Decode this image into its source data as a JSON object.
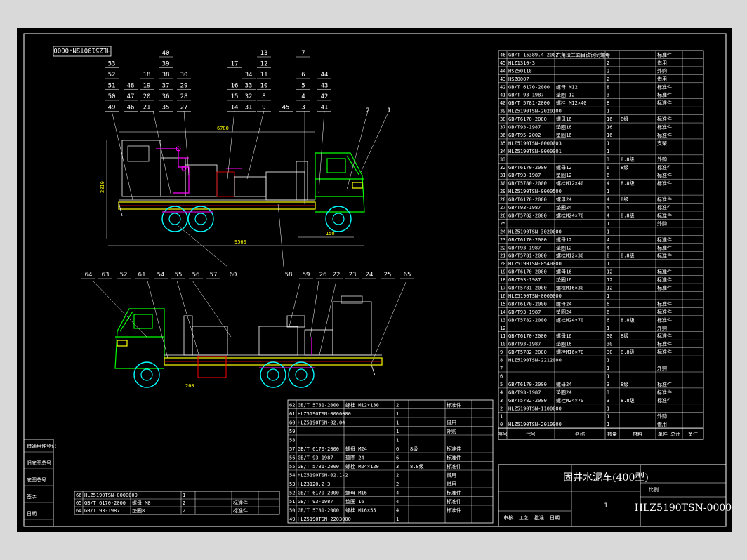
{
  "stamp": "HLZ5190TSN-0000",
  "dimensions": {
    "top_total": "6780",
    "top_height": "2810",
    "top_wheelbase": "9560",
    "top_gap": "150",
    "bottom_gap": "260"
  },
  "callouts_top": {
    "row1": [
      "40",
      "7",
      "13"
    ],
    "row2": [
      "53",
      "39",
      "12",
      "17"
    ],
    "row3": [
      "52",
      "18",
      "38",
      "30",
      "34",
      "11",
      "6",
      "44"
    ],
    "row4": [
      "51",
      "48",
      "19",
      "37",
      "29",
      "16",
      "33",
      "10",
      "5",
      "43"
    ],
    "row5": [
      "50",
      "47",
      "20",
      "36",
      "28",
      "15",
      "32",
      "8",
      "4",
      "42"
    ],
    "row6": [
      "49",
      "46",
      "21",
      "35",
      "27",
      "14",
      "31",
      "9",
      "45",
      "3",
      "41"
    ],
    "right": [
      "2",
      "1"
    ],
    "lower": [
      "60",
      "58"
    ]
  },
  "callouts_bottom": [
    "64",
    "63",
    "52",
    "61",
    "54",
    "55",
    "56",
    "57",
    "59",
    "26",
    "22",
    "23",
    "24",
    "25",
    "65"
  ],
  "bom_right": [
    [
      "46",
      "GB/T 15389.4-2002",
      "六角法兰面自锁钢制螺母",
      "8",
      "",
      "标准件"
    ],
    [
      "45",
      "HLZ1310-3",
      "",
      "2",
      "",
      "借用"
    ],
    [
      "44",
      "HSZ50118",
      "",
      "2",
      "",
      "外购"
    ],
    [
      "43",
      "HSZ0007",
      "",
      "2",
      "",
      "借用"
    ],
    [
      "42",
      "GB/T 6170-2000",
      "螺母 M12",
      "8",
      "",
      "标准件"
    ],
    [
      "41",
      "GB/T 93-1987",
      "垫圈 12",
      "3",
      "",
      "标准件"
    ],
    [
      "40",
      "GB/T 5781-2000",
      "螺栓 M12×40",
      "8",
      "",
      "标准件"
    ],
    [
      "39",
      "HLZ5190TSN-2020100",
      "",
      "1",
      "",
      ""
    ],
    [
      "38",
      "GB/T6170-2000",
      "螺母16",
      "16",
      "8级",
      "标准件"
    ],
    [
      "37",
      "GB/T93-1987",
      "垫圈16",
      "16",
      "",
      "标准件"
    ],
    [
      "36",
      "GB/T95-2002",
      "垫圈16",
      "16",
      "",
      "标准件"
    ],
    [
      "35",
      "HLZ5190TSN-0000003",
      "",
      "1",
      "",
      "支架"
    ],
    [
      "34",
      "HLZ5190TSN-0000001",
      "",
      "1",
      "",
      ""
    ],
    [
      "33",
      "",
      "",
      "3",
      "8.8级",
      "外购"
    ],
    [
      "32",
      "GB/T6170-2000",
      "螺母12",
      "6",
      "8级",
      "标准件"
    ],
    [
      "31",
      "GB/T93-1987",
      "垫圈12",
      "6",
      "",
      "标准件"
    ],
    [
      "30",
      "GB/T5780-2000",
      "螺栓M12×40",
      "4",
      "8.8级",
      "标准件"
    ],
    [
      "29",
      "HLZ5190TSN-0000500",
      "",
      "1",
      "",
      ""
    ],
    [
      "28",
      "GB/T6170-2000",
      "螺母24",
      "4",
      "8级",
      "标准件"
    ],
    [
      "27",
      "GB/T93-1987",
      "垫圈24",
      "4",
      "",
      "标准件"
    ],
    [
      "26",
      "GB/T5782-2000",
      "螺栓M24×70",
      "4",
      "8.8级",
      "标准件"
    ],
    [
      "25",
      "",
      "",
      "1",
      "",
      "外购"
    ],
    [
      "24",
      "HLZ5190TSN-3020000",
      "",
      "1",
      "",
      ""
    ],
    [
      "23",
      "GB/T6170-2000",
      "螺母12",
      "4",
      "",
      "标准件"
    ],
    [
      "22",
      "GB/T93-1987",
      "垫圈12",
      "4",
      "",
      "标准件"
    ],
    [
      "21",
      "GB/T5781-2000",
      "螺栓M12×30",
      "8",
      "8.8级",
      "标准件"
    ],
    [
      "20",
      "HLZ5190TSN-0540000",
      "",
      "1",
      "",
      ""
    ],
    [
      "19",
      "GB/T6170-2000",
      "螺母16",
      "12",
      "",
      "标准件"
    ],
    [
      "18",
      "GB/T93-1987",
      "垫圈16",
      "12",
      "",
      "标准件"
    ],
    [
      "17",
      "GB/T5781-2000",
      "螺栓M16×30",
      "12",
      "",
      "标准件"
    ],
    [
      "16",
      "HLZ5190TSN-0000000",
      "",
      "1",
      "",
      ""
    ],
    [
      "15",
      "GB/T6170-2000",
      "螺母24",
      "6",
      "",
      "标准件"
    ],
    [
      "14",
      "GB/T93-1987",
      "垫圈24",
      "6",
      "",
      "标准件"
    ],
    [
      "13",
      "GB/T5782-2000",
      "螺栓M24×70",
      "6",
      "8.8级",
      "标准件"
    ],
    [
      "12",
      "",
      "",
      "1",
      "",
      "外购"
    ],
    [
      "11",
      "GB/T6170-2000",
      "螺母16",
      "30",
      "8级",
      "标准件"
    ],
    [
      "10",
      "GB/T93-1987",
      "垫圈16",
      "30",
      "",
      "标准件"
    ],
    [
      "9",
      "GB/T5782-2000",
      "螺栓M16×70",
      "30",
      "8.8级",
      "标准件"
    ],
    [
      "8",
      "HLZ5190TSN-2212000",
      "",
      "1",
      "",
      ""
    ],
    [
      "7",
      "",
      "",
      "1",
      "",
      "外购"
    ],
    [
      "6",
      "",
      "",
      "1",
      "",
      ""
    ],
    [
      "5",
      "GB/T6170-2000",
      "螺母24",
      "3",
      "8级",
      "标准件"
    ],
    [
      "4",
      "GB/T93-1987",
      "垫圈24",
      "3",
      "",
      "标准件"
    ],
    [
      "3",
      "GB/T5782-2000",
      "螺栓M24×70",
      "3",
      "8.8级",
      "标准件"
    ],
    [
      "2",
      "HLZ5190TSN-1100000",
      "",
      "1",
      "",
      ""
    ],
    [
      "1",
      "",
      "",
      "1",
      "",
      "外购"
    ],
    [
      "0",
      "HLZ5190TSN-2010000",
      "",
      "1",
      "",
      "借用"
    ]
  ],
  "bom_right_header": [
    "序号",
    "代号",
    "名称",
    "数量",
    "材料",
    "单件 总计",
    "备注"
  ],
  "bom_bottom": [
    [
      "62",
      "GB/T 5781-2000",
      "螺栓 M12×130",
      "2",
      "",
      "标准件"
    ],
    [
      "61",
      "HLZ5190TSN-0000000",
      "",
      "1",
      "",
      ""
    ],
    [
      "60",
      "HLZ5190TSN-02.04",
      "",
      "1",
      "",
      "借用"
    ],
    [
      "59",
      "",
      "",
      "1",
      "",
      "外购"
    ],
    [
      "58",
      "",
      "",
      "1",
      "",
      ""
    ],
    [
      "57",
      "GB/T 6170-2000",
      "螺母 M24",
      "6",
      "8级",
      "标准件"
    ],
    [
      "56",
      "GB/T 93-1987",
      "垫圈 24",
      "6",
      "",
      "标准件"
    ],
    [
      "55",
      "GB/T 5781-2000",
      "螺栓 M24×120",
      "3",
      "8.8级",
      "标准件"
    ],
    [
      "54",
      "HLZ5190TSN-02.1-2",
      "",
      "2",
      "",
      "借用"
    ],
    [
      "53",
      "HLZ3120.2-3",
      "",
      "2",
      "",
      "借用"
    ],
    [
      "52",
      "GB/T 6170-2000",
      "螺母 M16",
      "4",
      "",
      "标准件"
    ],
    [
      "51",
      "GB/T 93-1987",
      "垫圈 16",
      "4",
      "",
      "标准件"
    ],
    [
      "50",
      "GB/T 5781-2000",
      "螺栓 M16×55",
      "4",
      "",
      "标准件"
    ],
    [
      "49",
      "HLZ5190TSN-2203000",
      "",
      "1",
      "",
      ""
    ]
  ],
  "bom_left": [
    [
      "66",
      "HLZ5190TSN-0000000",
      "",
      "1",
      "",
      ""
    ],
    [
      "65",
      "GB/T 6170-2000",
      "螺母 M8",
      "2",
      "",
      "标准件"
    ],
    [
      "64",
      "GB/T 93-1987",
      "垫圈8",
      "2",
      "",
      "标准件"
    ]
  ],
  "title_block": {
    "product_name": "固井水泥车(400型)",
    "drawing_no": "HLZ5190TSN-0000",
    "sheet_no": "1",
    "scale_label": "比例"
  },
  "revision_labels": [
    "审核",
    "工艺",
    "批准",
    "日期"
  ],
  "left_strip_labels": [
    "借通用件登记",
    "旧底图总号",
    "底图总号",
    "签字",
    "日期"
  ]
}
